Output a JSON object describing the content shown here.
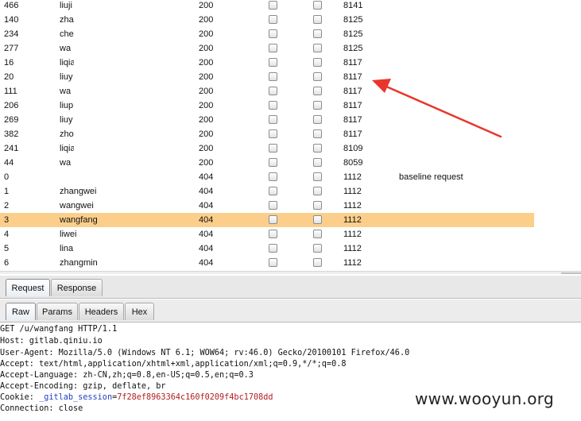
{
  "results": {
    "rows": [
      {
        "id": "466",
        "payload": "liuji",
        "status": "200",
        "length": "8141",
        "comment": ""
      },
      {
        "id": "140",
        "payload": "zha",
        "status": "200",
        "length": "8125",
        "comment": ""
      },
      {
        "id": "234",
        "payload": "che",
        "status": "200",
        "length": "8125",
        "comment": ""
      },
      {
        "id": "277",
        "payload": "wa",
        "status": "200",
        "length": "8125",
        "comment": ""
      },
      {
        "id": "16",
        "payload": "liqia",
        "status": "200",
        "length": "8117",
        "comment": ""
      },
      {
        "id": "20",
        "payload": "liuy",
        "status": "200",
        "length": "8117",
        "comment": ""
      },
      {
        "id": "111",
        "payload": "wa",
        "status": "200",
        "length": "8117",
        "comment": ""
      },
      {
        "id": "206",
        "payload": "liup",
        "status": "200",
        "length": "8117",
        "comment": ""
      },
      {
        "id": "269",
        "payload": "liuy",
        "status": "200",
        "length": "8117",
        "comment": ""
      },
      {
        "id": "382",
        "payload": "zho",
        "status": "200",
        "length": "8117",
        "comment": ""
      },
      {
        "id": "241",
        "payload": "liqia",
        "status": "200",
        "length": "8109",
        "comment": ""
      },
      {
        "id": "44",
        "payload": "wa",
        "status": "200",
        "length": "8059",
        "comment": ""
      },
      {
        "id": "0",
        "payload": "",
        "status": "404",
        "length": "1112",
        "comment": "baseline request"
      },
      {
        "id": "1",
        "payload": "zhangwei",
        "status": "404",
        "length": "1112",
        "comment": ""
      },
      {
        "id": "2",
        "payload": "wangwei",
        "status": "404",
        "length": "1112",
        "comment": ""
      },
      {
        "id": "3",
        "payload": "wangfang",
        "status": "404",
        "length": "1112",
        "comment": "",
        "selected": true
      },
      {
        "id": "4",
        "payload": "liwei",
        "status": "404",
        "length": "1112",
        "comment": ""
      },
      {
        "id": "5",
        "payload": "lina",
        "status": "404",
        "length": "1112",
        "comment": ""
      },
      {
        "id": "6",
        "payload": "zhangmin",
        "status": "404",
        "length": "1112",
        "comment": ""
      }
    ]
  },
  "tabs": {
    "outer": [
      {
        "label": "Request",
        "active": true
      },
      {
        "label": "Response",
        "active": false
      }
    ],
    "inner": [
      {
        "label": "Raw",
        "active": true
      },
      {
        "label": "Params",
        "active": false
      },
      {
        "label": "Headers",
        "active": false
      },
      {
        "label": "Hex",
        "active": false
      }
    ]
  },
  "request": {
    "lines": [
      "GET /u/wangfang HTTP/1.1",
      "Host: gitlab.qiniu.io",
      "User-Agent: Mozilla/5.0 (Windows NT 6.1; WOW64; rv:46.0) Gecko/20100101 Firefox/46.0",
      "Accept: text/html,application/xhtml+xml,application/xml;q=0.9,*/*;q=0.8",
      "Accept-Language: zh-CN,zh;q=0.8,en-US;q=0.5,en;q=0.3",
      "Accept-Encoding: gzip, deflate, br"
    ],
    "cookie": {
      "label": "Cookie: ",
      "name": "_gitlab_session",
      "eq": "=",
      "value": "7f28ef8963364c160f0209f4bc1708dd"
    },
    "connection": "Connection: close"
  },
  "watermark": "www.wooyun.org",
  "colors": {
    "selected_row": "#fbcf8b",
    "annotation_arrow": "#e8362c"
  }
}
